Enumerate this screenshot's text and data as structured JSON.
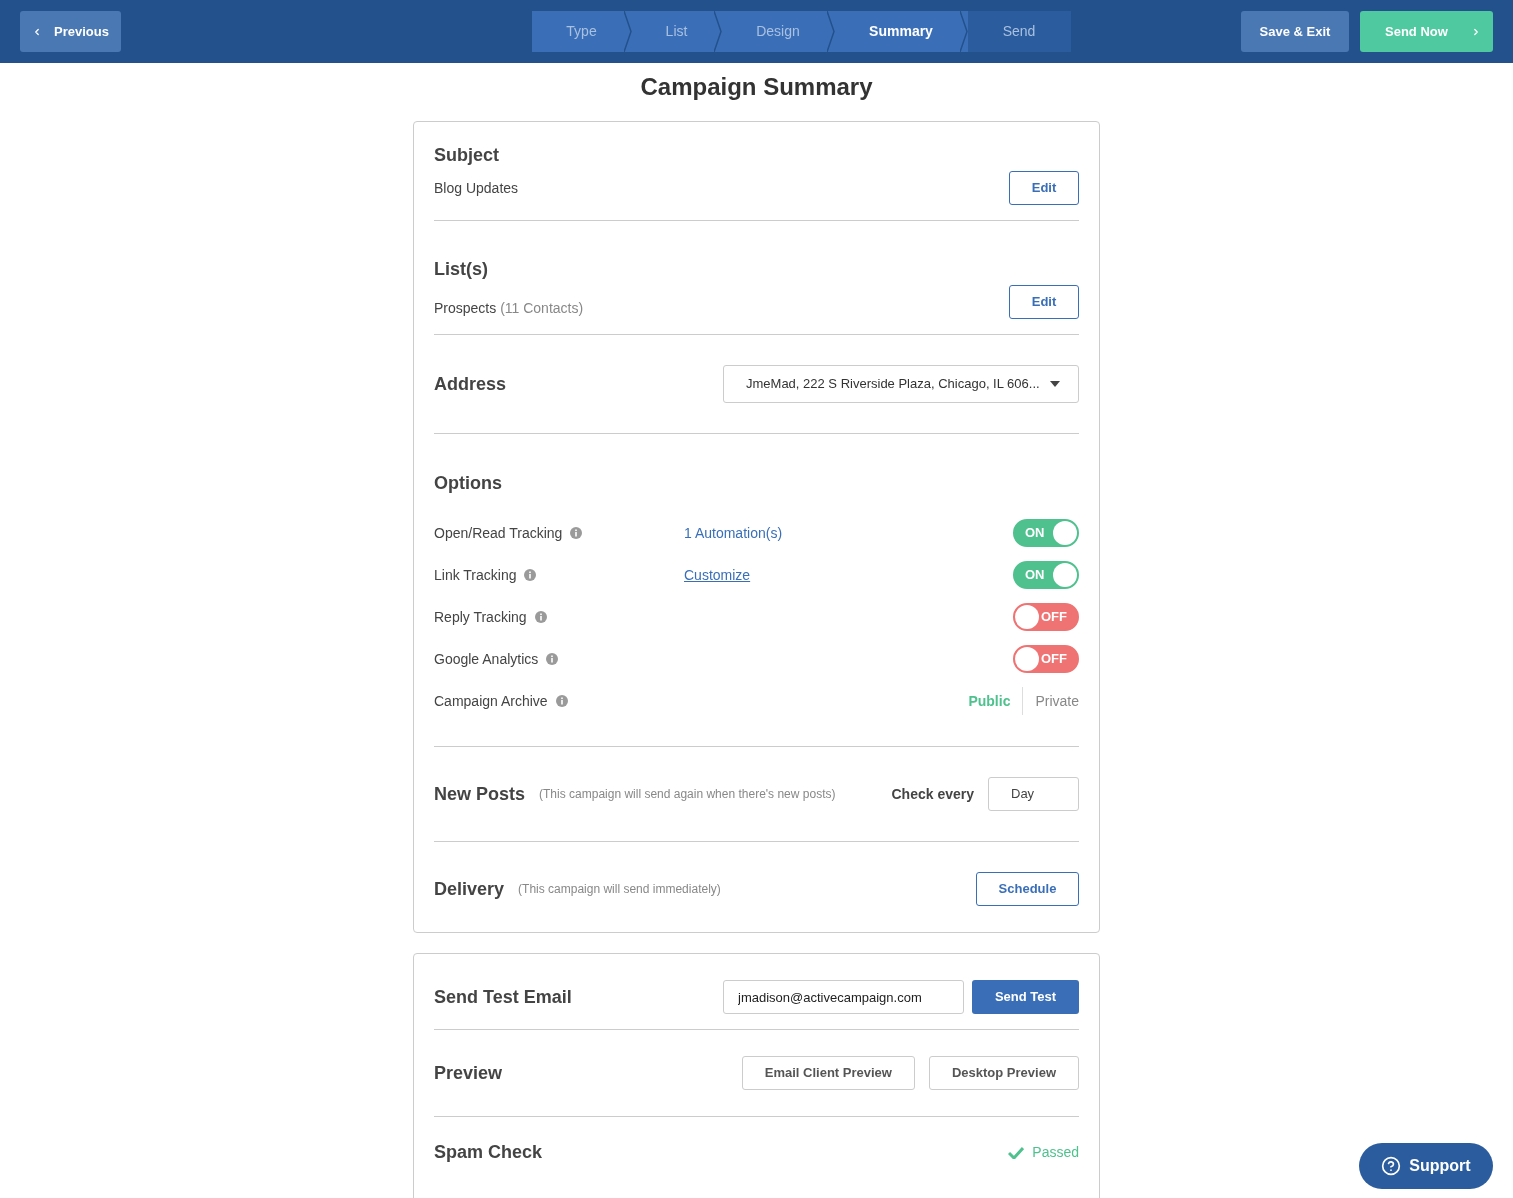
{
  "header": {
    "previous": "Previous",
    "steps": [
      {
        "label": "Type",
        "selected": false,
        "completed": true
      },
      {
        "label": "List",
        "selected": false,
        "completed": true
      },
      {
        "label": "Design",
        "selected": false,
        "completed": true
      },
      {
        "label": "Summary",
        "selected": true,
        "completed": true
      },
      {
        "label": "Send",
        "selected": false,
        "completed": false
      }
    ],
    "save_exit": "Save & Exit",
    "send_now": "Send Now"
  },
  "title": "Campaign Summary",
  "subject": {
    "heading": "Subject",
    "value": "Blog Updates",
    "edit": "Edit"
  },
  "lists": {
    "heading": "List(s)",
    "name": "Prospects",
    "count": "(11 Contacts)",
    "edit": "Edit"
  },
  "address": {
    "heading": "Address",
    "value": "JmeMad, 222 S Riverside Plaza, Chicago, IL 606..."
  },
  "options": {
    "heading": "Options",
    "rows": [
      {
        "kind": "toggle",
        "label": "Open/Read Tracking",
        "link": "1 Automation(s)",
        "link_underlined": false,
        "on": true,
        "toggle_text": "ON"
      },
      {
        "kind": "toggle",
        "label": "Link Tracking",
        "link": "Customize",
        "link_underlined": true,
        "on": true,
        "toggle_text": "ON"
      },
      {
        "kind": "toggle",
        "label": "Reply Tracking",
        "on": false,
        "toggle_text": "OFF"
      },
      {
        "kind": "toggle",
        "label": "Google Analytics",
        "on": false,
        "toggle_text": "OFF"
      },
      {
        "kind": "choice",
        "label": "Campaign Archive",
        "choices": [
          {
            "label": "Public",
            "selected": true
          },
          {
            "label": "Private",
            "selected": false
          }
        ]
      }
    ]
  },
  "new_posts": {
    "heading": "New Posts",
    "note": "(This campaign will send again when there's new posts)",
    "check_label": "Check every",
    "interval": "Day"
  },
  "delivery": {
    "heading": "Delivery",
    "note": "(This campaign will send immediately)",
    "schedule": "Schedule"
  },
  "test_email": {
    "heading": "Send Test Email",
    "email": "jmadison@activecampaign.com",
    "button": "Send Test"
  },
  "preview": {
    "heading": "Preview",
    "buttons": [
      "Email Client Preview",
      "Desktop Preview"
    ]
  },
  "spam_check": {
    "heading": "Spam Check",
    "status": "Passed"
  },
  "support": "Support"
}
